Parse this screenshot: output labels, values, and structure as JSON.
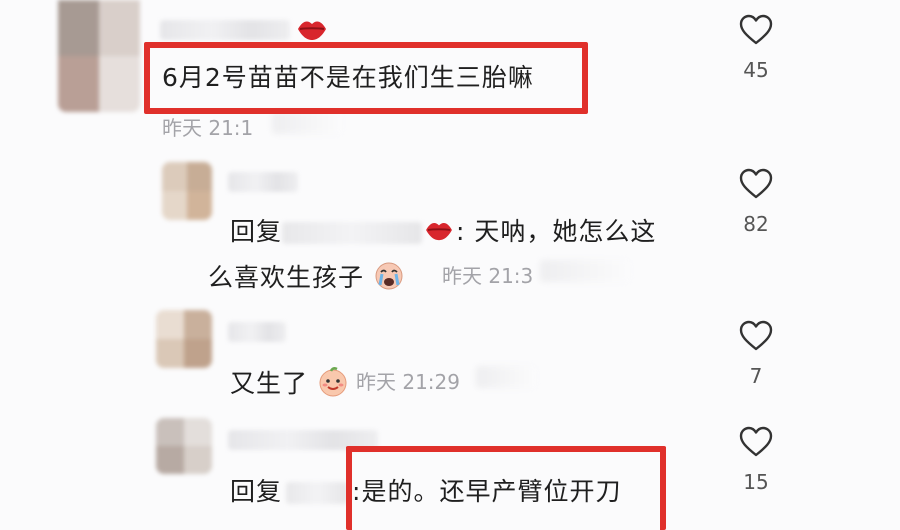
{
  "comments": [
    {
      "text": "6月2号苗苗不是在我们生三胎嘛",
      "time": "昨天 21:1",
      "likes": "45",
      "emoji": "lips"
    },
    {
      "reply_prefix": "回复",
      "reply_text_line1": ": 天呐，她怎么这",
      "reply_text_line2": "么喜欢生孩子",
      "time": "昨天 21:3",
      "likes": "82",
      "emoji_inline": "lips",
      "emoji_end": "crying-face"
    },
    {
      "text": "又生了",
      "time": "昨天 21:29",
      "likes": "7",
      "emoji": "peach-face"
    },
    {
      "reply_prefix": "回复",
      "reply_text": ":是的。还早产臂位开刀",
      "likes": "15"
    }
  ],
  "colors": {
    "highlight": "#e0302b",
    "text": "#1f1f1f",
    "meta": "#a3a3a8",
    "like_stroke": "#333333"
  },
  "icons": [
    "heart-icon",
    "lips-emoji-icon",
    "crying-face-emoji-icon",
    "peach-face-emoji-icon"
  ]
}
